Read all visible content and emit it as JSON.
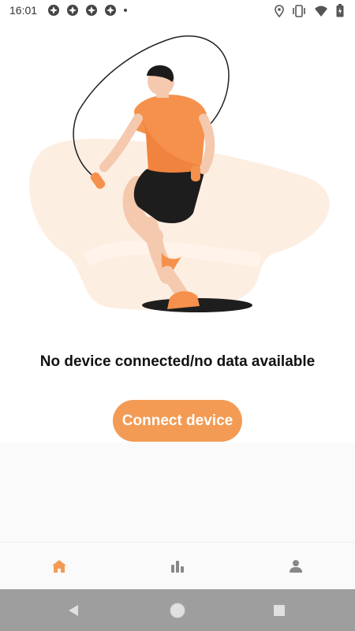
{
  "status_bar": {
    "time": "16:01",
    "notification_icons": [
      "app-notification-icon",
      "app-notification-icon",
      "app-notification-icon",
      "app-notification-icon"
    ],
    "right_icons": [
      "location-icon",
      "vibrate-icon",
      "wifi-icon",
      "battery-icon"
    ]
  },
  "main": {
    "illustration": "man-jumping-rope",
    "message": "No device connected/no data available",
    "connect_button_label": "Connect device"
  },
  "bottom_nav": {
    "items": [
      {
        "icon": "home-icon",
        "active": true
      },
      {
        "icon": "stats-icon",
        "active": false
      },
      {
        "icon": "profile-icon",
        "active": false
      }
    ]
  },
  "system_nav": [
    "back-icon",
    "home-circle-icon",
    "recents-icon"
  ],
  "colors": {
    "accent": "#f39b54",
    "illustration_blob": "#fdeee2",
    "nav_inactive": "#888888",
    "system_nav_bg": "#9e9e9e"
  }
}
